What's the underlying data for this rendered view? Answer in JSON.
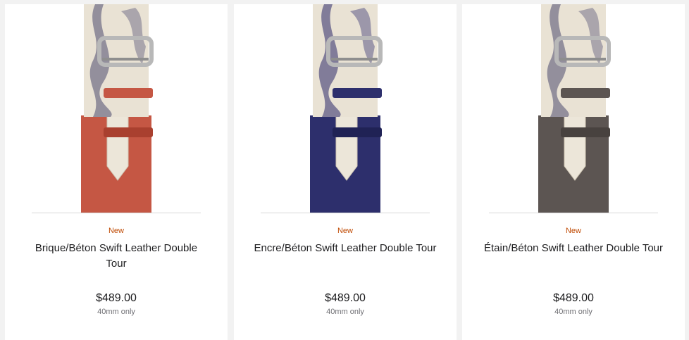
{
  "products": [
    {
      "badge": "New",
      "title": "Brique/Béton Swift Leather Double Tour",
      "price": "$489.00",
      "note": "40mm only",
      "band_color": "#c55744",
      "band_dark": "#a9402f"
    },
    {
      "badge": "New",
      "title": "Encre/Béton Swift Leather Double Tour",
      "price": "$489.00",
      "note": "40mm only",
      "band_color": "#2d2f6c",
      "band_dark": "#202255"
    },
    {
      "badge": "New",
      "title": "Étain/Béton Swift Leather Double Tour",
      "price": "$489.00",
      "note": "40mm only",
      "band_color": "#5c5552",
      "band_dark": "#48423f"
    }
  ],
  "colors": {
    "badge": "#bf4800",
    "beton": "#e9e2d4",
    "print": "#76738a"
  }
}
